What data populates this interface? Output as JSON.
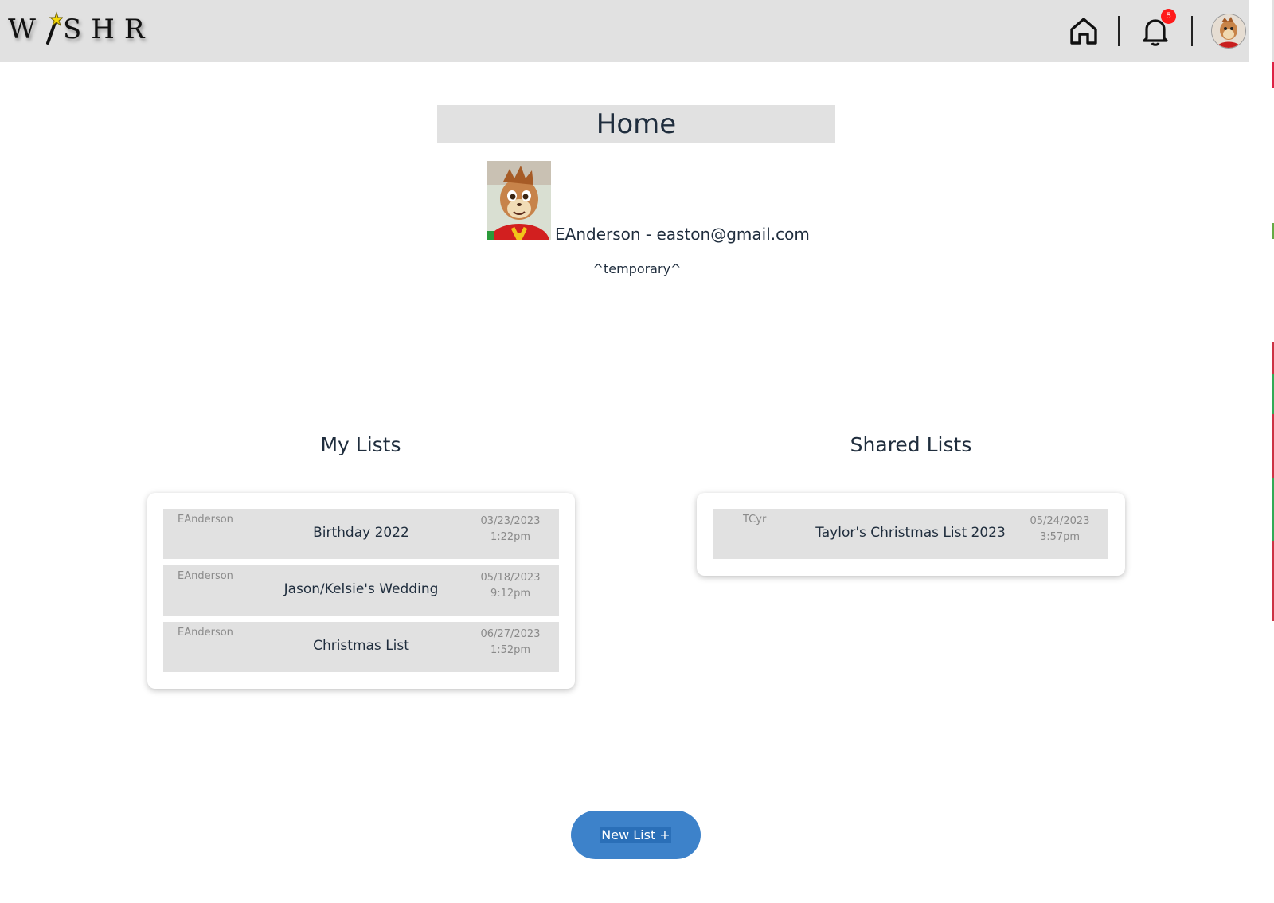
{
  "header": {
    "logo_text_left": "W",
    "logo_text_right": "SHR",
    "notification_count": "5",
    "icons": [
      "wand-icon",
      "home-icon",
      "bell-icon",
      "avatar"
    ]
  },
  "page": {
    "title": "Home",
    "user_line": "EAnderson - easton@gmail.com",
    "temp_note": "^temporary^"
  },
  "my_lists": {
    "heading": "My Lists",
    "items": [
      {
        "owner": "EAnderson",
        "title": "Birthday 2022",
        "date": "03/23/2023",
        "time": "1:22pm"
      },
      {
        "owner": "EAnderson",
        "title": "Jason/Kelsie's Wedding",
        "date": "05/18/2023",
        "time": "9:12pm"
      },
      {
        "owner": "EAnderson",
        "title": "Christmas List",
        "date": "06/27/2023",
        "time": "1:52pm"
      }
    ]
  },
  "shared_lists": {
    "heading": "Shared Lists",
    "items": [
      {
        "owner": "TCyr",
        "title": "Taylor's Christmas List 2023",
        "date": "05/24/2023",
        "time": "3:57pm"
      }
    ]
  },
  "actions": {
    "new_list_label": "New List +"
  },
  "colors": {
    "topbar": "#e1e1e1",
    "accent": "#3d82ca",
    "badge": "#ff1a1a",
    "row_bg": "#e1e1e1",
    "text": "#1f2d3d",
    "muted": "#8a8a8a"
  }
}
